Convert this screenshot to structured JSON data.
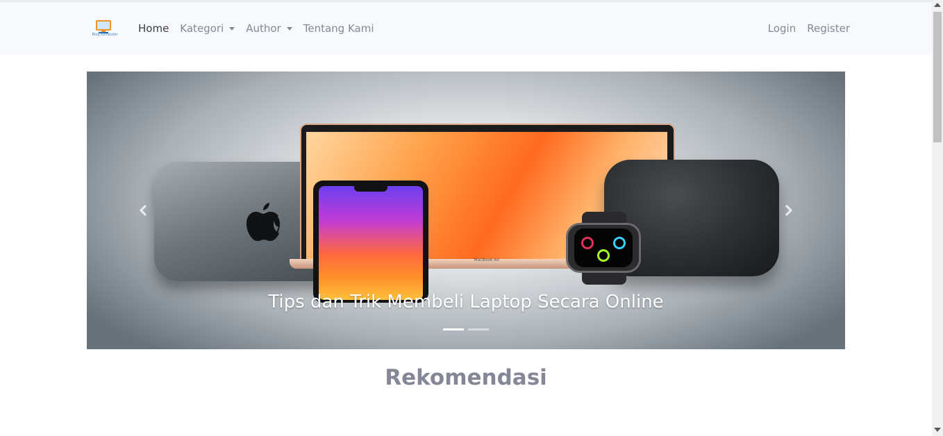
{
  "navbar": {
    "brand_text": "Blog Komputer",
    "links_left": [
      {
        "label": "Home",
        "active": true,
        "dropdown": false
      },
      {
        "label": "Kategori",
        "active": false,
        "dropdown": true
      },
      {
        "label": "Author",
        "active": false,
        "dropdown": true
      },
      {
        "label": "Tentang Kami",
        "active": false,
        "dropdown": false
      }
    ],
    "links_right": [
      {
        "label": "Login"
      },
      {
        "label": "Register"
      }
    ]
  },
  "carousel": {
    "caption": "Tips dan Trik Membeli Laptop Secara Online",
    "laptop_label": "MacBook Air",
    "slide_count": 2,
    "active_slide": 1
  },
  "main": {
    "section_title": "Rekomendasi"
  },
  "colors": {
    "navbar_bg": "#f8f9fc",
    "nav_text": "#858796",
    "nav_active": "#3a3b45",
    "section_title": "#858796"
  }
}
